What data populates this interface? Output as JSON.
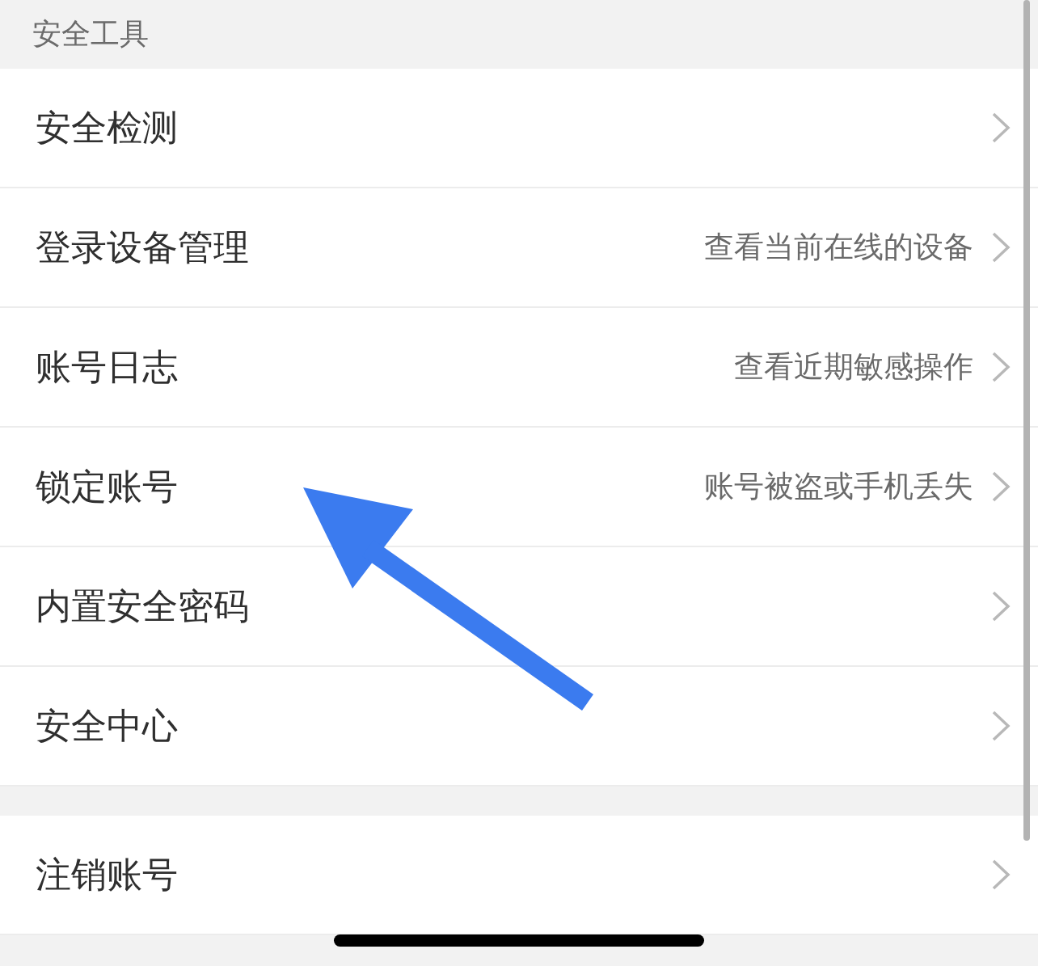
{
  "section_title": "安全工具",
  "groups": [
    {
      "items": [
        {
          "label": "安全检测"
        },
        {
          "label": "登录设备管理",
          "detail": "查看当前在线的设备"
        },
        {
          "label": "账号日志",
          "detail": "查看近期敏感操作"
        },
        {
          "label": "锁定账号",
          "detail": "账号被盗或手机丢失"
        },
        {
          "label": "内置安全密码"
        },
        {
          "label": "安全中心"
        }
      ]
    },
    {
      "items": [
        {
          "label": "注销账号"
        }
      ]
    }
  ]
}
